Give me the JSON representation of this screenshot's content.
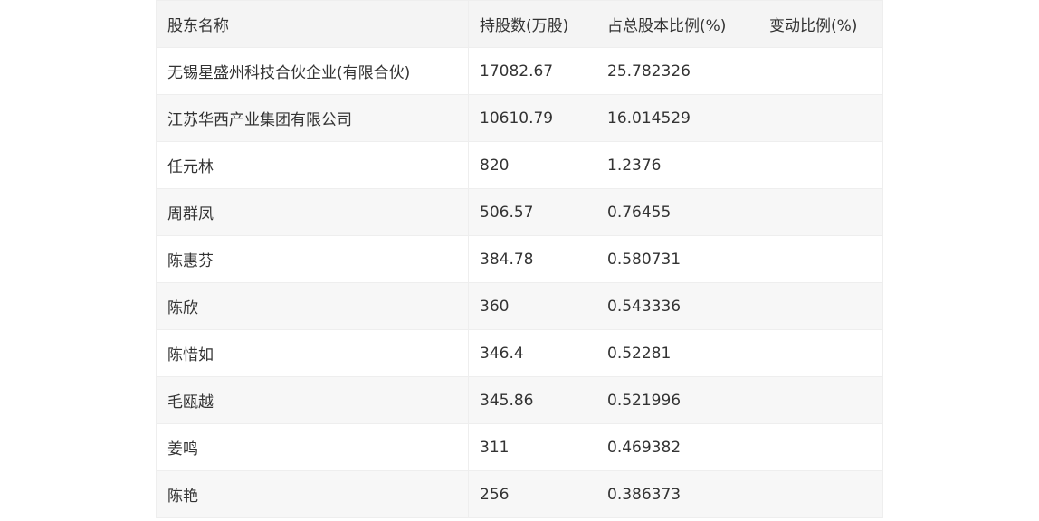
{
  "table": {
    "headers": [
      "股东名称",
      "持股数(万股)",
      "占总股本比例(%)",
      "变动比例(%)"
    ],
    "rows": [
      [
        "无锡星盛州科技合伙企业(有限合伙)",
        "17082.67",
        "25.782326",
        ""
      ],
      [
        "江苏华西产业集团有限公司",
        "10610.79",
        "16.014529",
        ""
      ],
      [
        "任元林",
        "820",
        "1.2376",
        ""
      ],
      [
        "周群凤",
        "506.57",
        "0.76455",
        ""
      ],
      [
        "陈惠芬",
        "384.78",
        "0.580731",
        ""
      ],
      [
        "陈欣",
        "360",
        "0.543336",
        ""
      ],
      [
        "陈惜如",
        "346.4",
        "0.52281",
        ""
      ],
      [
        "毛瓯越",
        "345.86",
        "0.521996",
        ""
      ],
      [
        "姜鸣",
        "311",
        "0.469382",
        ""
      ],
      [
        "陈艳",
        "256",
        "0.386373",
        ""
      ]
    ]
  }
}
